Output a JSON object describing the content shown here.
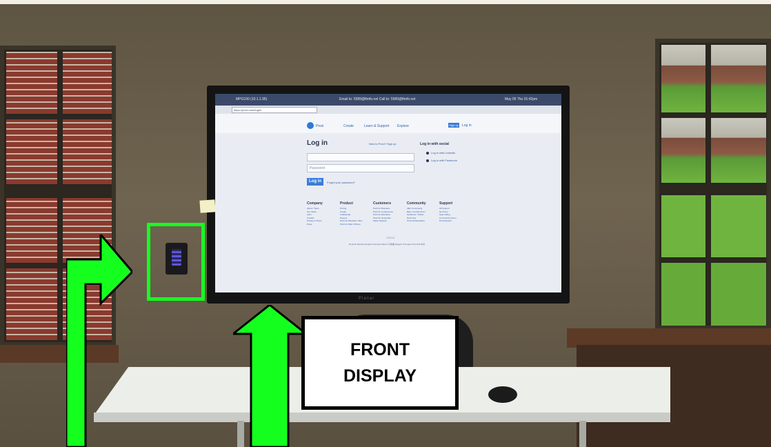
{
  "annotation": {
    "label": "FRONT\nDISPLAY",
    "highlight_color": "#15ff1f",
    "arrow_color": "#15ff1f"
  },
  "display": {
    "brand": "Planar",
    "taskbar": {
      "left": "MPG100 (10.1.1.95)",
      "center": "Email to: 5589@ftmfo.net   Call to: 5589@ftmfo.net",
      "right": "May 05   Thu 01:42pm"
    },
    "browser": {
      "url": "https://prezi.com/login/"
    },
    "page": {
      "logo": "Prezi",
      "nav": [
        "Create",
        "Learn & Support",
        "Explore"
      ],
      "signup": "Sign up",
      "login_link": "Log in",
      "title": "Log in",
      "new_prezi": "New to Prezi? Sign up",
      "email_placeholder": "",
      "password_placeholder": "Password",
      "login_button": "Log in",
      "forgot": "Forgot your password?",
      "social_title": "Log in with social",
      "social_options": [
        "Log in with LinkedIn",
        "Log in with Facebook"
      ],
      "footer": [
        {
          "heading": "Company",
          "items": [
            "About / Team",
            "Our Vision",
            "Jobs",
            "Contact",
            "Privacy & Terms",
            "Press"
          ]
        },
        {
          "heading": "Product",
          "items": [
            "Pricing",
            "Create",
            "Collaborate",
            "Present",
            "Prezi for Windows / Mac",
            "Prezi for iPad / iPhone"
          ]
        },
        {
          "heading": "Customers",
          "items": [
            "Prezi for Business",
            "Prezi for Conferences",
            "Prezi for Education",
            "Prezi for Nonprofits",
            "Talent Network"
          ]
        },
        {
          "heading": "Community",
          "items": [
            "AEC Community",
            "Blog / Contact Prezi",
            "Facebook / Twitter",
            "Prezi Tips",
            "Prezi Ambassadors"
          ]
        },
        {
          "heading": "Support",
          "items": [
            "All Support",
            "Get Prezi",
            "Help a Blog",
            "Community Forum",
            "Prezi Experts"
          ]
        }
      ],
      "copyright": "©2015",
      "languages": "Deutsch   Español   English   Français   Italiano   日本語   Magyar   Português   Русский   中文"
    }
  }
}
